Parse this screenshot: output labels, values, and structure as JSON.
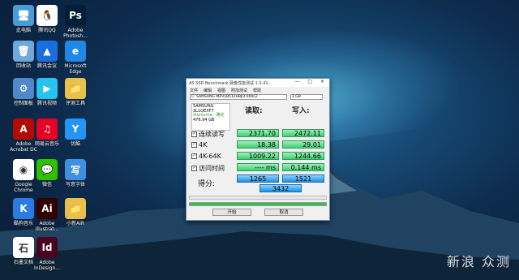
{
  "desktop_icons": [
    {
      "label": "此电脑",
      "color": "#4b9bd8",
      "glyph": "🖥"
    },
    {
      "label": "腾讯QQ",
      "color": "#ffffff",
      "glyph": "🐧"
    },
    {
      "label": "Adobe\nPhotosh...",
      "color": "#001e36",
      "glyph": "Ps"
    },
    {
      "label": "回收站",
      "color": "#6fa8dc",
      "glyph": "🗑"
    },
    {
      "label": "腾讯会议",
      "color": "#1a6fe0",
      "glyph": "▲"
    },
    {
      "label": "Microsoft\nEdge",
      "color": "#1e88e5",
      "glyph": "e"
    },
    {
      "label": "控制面板",
      "color": "#4f89c7",
      "glyph": "⚙"
    },
    {
      "label": "腾讯视频",
      "color": "#25c3f0",
      "glyph": "▶"
    },
    {
      "label": "评测工具",
      "color": "#e8c14a",
      "glyph": "📁"
    },
    {
      "label": "Adobe\nAcrobat DC",
      "color": "#b30b00",
      "glyph": "A"
    },
    {
      "label": "网易云音乐",
      "color": "#e60026",
      "glyph": "♫"
    },
    {
      "label": "优酷",
      "color": "#2196f3",
      "glyph": "Y"
    },
    {
      "label": "Google\nChrome",
      "color": "#ffffff",
      "glyph": "◉"
    },
    {
      "label": "微信",
      "color": "#2dc100",
      "glyph": "💬"
    },
    {
      "label": "写意字体",
      "color": "#3d8fe0",
      "glyph": "写"
    },
    {
      "label": "酷狗音乐",
      "color": "#2b7be0",
      "glyph": "K"
    },
    {
      "label": "Adobe\nIllustrat...",
      "color": "#330000",
      "glyph": "Ai"
    },
    {
      "label": "小新AIR",
      "color": "#e8c14a",
      "glyph": "📁"
    },
    {
      "label": "石墨文档",
      "color": "#ffffff",
      "glyph": "石"
    },
    {
      "label": "Adobe\nInDesign...",
      "color": "#49021f",
      "glyph": "Id"
    }
  ],
  "window": {
    "title": "AS SSD Benchmark 硬盘性能测试 1.0.41...",
    "controls": "— □ ✕",
    "menu": [
      "文件",
      "编辑",
      "视图",
      "附加测试",
      "帮助"
    ],
    "drive_select": "C: SAMSUNG MZVLB512HBJQ-000L2",
    "size_select": "1 GB",
    "info": {
      "model": "SAMSUNG",
      "serial": "3L1QEXF7",
      "driver": "stornvme - 确定",
      "size": "476.94 GB"
    },
    "col_read": "读取:",
    "col_write": "写入:",
    "rows": [
      {
        "label": "连续读写",
        "read": "2371.70",
        "write": "2472.11"
      },
      {
        "label": "4K",
        "read": "18.38",
        "write": "29.01"
      },
      {
        "label": "4K-64K",
        "read": "1009.22",
        "write": "1244.66"
      },
      {
        "label": "访问时间",
        "read": "---- ms",
        "write": "0.144 ms"
      }
    ],
    "score_label": "得分:",
    "score_read": "1265",
    "score_write": "1521",
    "score_total": "3432",
    "start_button": "开始",
    "cancel_button": "取消"
  },
  "watermark": "新浪 众测"
}
